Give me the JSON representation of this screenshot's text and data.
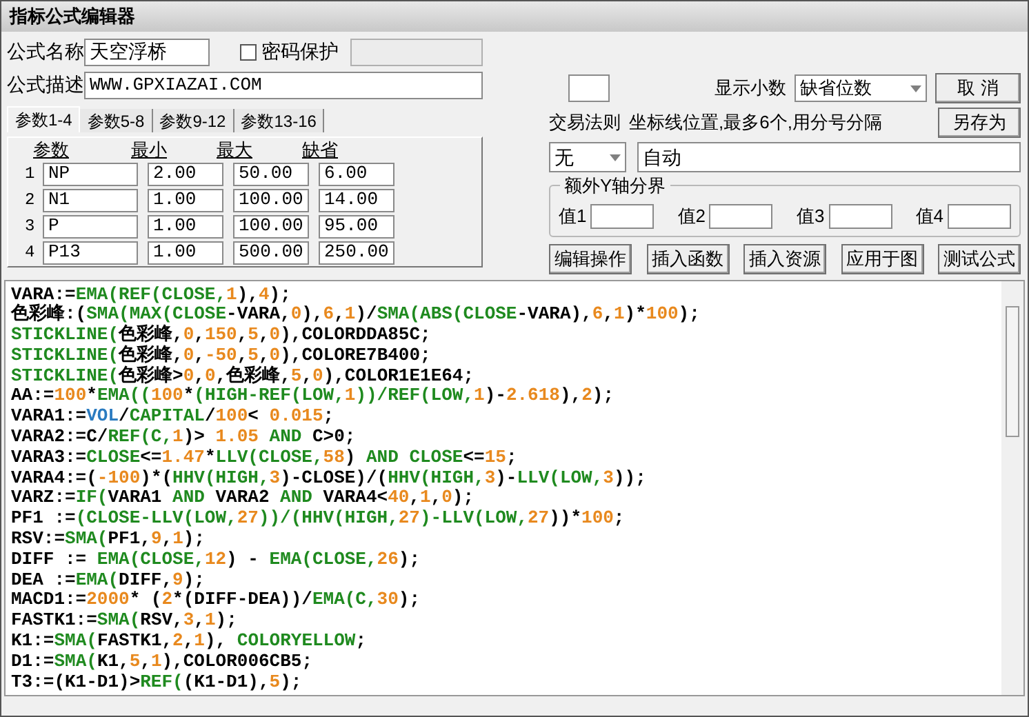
{
  "window": {
    "title": "指标公式编辑器"
  },
  "formula": {
    "name_label": "公式名称",
    "name_value": "天空浮桥",
    "password": {
      "label": "密码保护",
      "checked": false,
      "field_disabled": true
    },
    "description_label": "公式描述",
    "description_value": "WWW.GPXIAZAI.COM"
  },
  "param_tabs": [
    {
      "label": "参数1-4",
      "selected": true
    },
    {
      "label": "参数5-8",
      "selected": false
    },
    {
      "label": "参数9-12",
      "selected": false
    },
    {
      "label": "参数13-16",
      "selected": false
    }
  ],
  "params": {
    "columns": [
      "参数",
      "最小",
      "最大",
      "缺省"
    ],
    "rows": [
      {
        "index": "1",
        "name": "NP",
        "min": "2.00",
        "max": "50.00",
        "default": "6.00"
      },
      {
        "index": "2",
        "name": "N1",
        "min": "1.00",
        "max": "100.00",
        "default": "14.00"
      },
      {
        "index": "3",
        "name": "P",
        "min": "1.00",
        "max": "100.00",
        "default": "95.00"
      },
      {
        "index": "4",
        "name": "P13",
        "min": "1.00",
        "max": "500.00",
        "default": "250.00"
      }
    ]
  },
  "display": {
    "digits_label": "显示小数",
    "digits_value": "缺省位数",
    "cancel_button": "取  消"
  },
  "trade_rule": {
    "label": "交易法则",
    "value": "无"
  },
  "axis_lines": {
    "label": "坐标线位置,最多6个,用分号分隔",
    "value": "自动"
  },
  "extra_y": {
    "title": "额外Y轴分界",
    "values": [
      {
        "label": "值1"
      },
      {
        "label": "值2"
      },
      {
        "label": "值3"
      },
      {
        "label": "值4"
      }
    ]
  },
  "save_as_button": "另存为",
  "actions": [
    "编辑操作",
    "插入函数",
    "插入资源",
    "应用于图",
    "测试公式"
  ],
  "code": {
    "lines": [
      [
        {
          "kind": "p",
          "text": "VARA:="
        },
        {
          "kind": "f",
          "text": "EMA(REF(CLOSE,"
        },
        {
          "kind": "n",
          "text": "1"
        },
        {
          "kind": "p",
          "text": "),"
        },
        {
          "kind": "n",
          "text": "4"
        },
        {
          "kind": "p",
          "text": ");"
        }
      ],
      [
        {
          "kind": "p",
          "text": "色彩峰:("
        },
        {
          "kind": "f",
          "text": "SMA(MAX(CLOSE"
        },
        {
          "kind": "p",
          "text": "-VARA,"
        },
        {
          "kind": "n",
          "text": "0"
        },
        {
          "kind": "p",
          "text": "),"
        },
        {
          "kind": "n",
          "text": "6"
        },
        {
          "kind": "p",
          "text": ","
        },
        {
          "kind": "n",
          "text": "1"
        },
        {
          "kind": "p",
          "text": ")/"
        },
        {
          "kind": "f",
          "text": "SMA(ABS(CLOSE"
        },
        {
          "kind": "p",
          "text": "-VARA),"
        },
        {
          "kind": "n",
          "text": "6"
        },
        {
          "kind": "p",
          "text": ","
        },
        {
          "kind": "n",
          "text": "1"
        },
        {
          "kind": "p",
          "text": ")*"
        },
        {
          "kind": "n",
          "text": "100"
        },
        {
          "kind": "p",
          "text": ");"
        }
      ],
      [
        {
          "kind": "f",
          "text": "STICKLINE("
        },
        {
          "kind": "p",
          "text": "色彩峰,"
        },
        {
          "kind": "n",
          "text": "0"
        },
        {
          "kind": "p",
          "text": ","
        },
        {
          "kind": "n",
          "text": "150"
        },
        {
          "kind": "p",
          "text": ","
        },
        {
          "kind": "n",
          "text": "5"
        },
        {
          "kind": "p",
          "text": ","
        },
        {
          "kind": "n",
          "text": "0"
        },
        {
          "kind": "p",
          "text": "),COLORDDA85C;"
        }
      ],
      [
        {
          "kind": "f",
          "text": "STICKLINE("
        },
        {
          "kind": "p",
          "text": "色彩峰,"
        },
        {
          "kind": "n",
          "text": "0"
        },
        {
          "kind": "p",
          "text": ","
        },
        {
          "kind": "n",
          "text": "-50"
        },
        {
          "kind": "p",
          "text": ","
        },
        {
          "kind": "n",
          "text": "5"
        },
        {
          "kind": "p",
          "text": ","
        },
        {
          "kind": "n",
          "text": "0"
        },
        {
          "kind": "p",
          "text": "),COLORE7B400;"
        }
      ],
      [
        {
          "kind": "f",
          "text": "STICKLINE("
        },
        {
          "kind": "p",
          "text": "色彩峰>"
        },
        {
          "kind": "n",
          "text": "0"
        },
        {
          "kind": "p",
          "text": ","
        },
        {
          "kind": "n",
          "text": "0"
        },
        {
          "kind": "p",
          "text": ",色彩峰,"
        },
        {
          "kind": "n",
          "text": "5"
        },
        {
          "kind": "p",
          "text": ","
        },
        {
          "kind": "n",
          "text": "0"
        },
        {
          "kind": "p",
          "text": "),COLOR1E1E64;"
        }
      ],
      [
        {
          "kind": "p",
          "text": "AA:="
        },
        {
          "kind": "n",
          "text": "100"
        },
        {
          "kind": "p",
          "text": "*"
        },
        {
          "kind": "f",
          "text": "EMA(("
        },
        {
          "kind": "n",
          "text": "100"
        },
        {
          "kind": "p",
          "text": "*"
        },
        {
          "kind": "f",
          "text": "(HIGH-REF(LOW,"
        },
        {
          "kind": "n",
          "text": "1"
        },
        {
          "kind": "f",
          "text": "))/REF(LOW,"
        },
        {
          "kind": "n",
          "text": "1"
        },
        {
          "kind": "p",
          "text": ")-"
        },
        {
          "kind": "n",
          "text": "2.618"
        },
        {
          "kind": "p",
          "text": "),"
        },
        {
          "kind": "n",
          "text": "2"
        },
        {
          "kind": "p",
          "text": ");"
        }
      ],
      [
        {
          "kind": "p",
          "text": "VARA1:="
        },
        {
          "kind": "v",
          "text": "VOL"
        },
        {
          "kind": "p",
          "text": "/"
        },
        {
          "kind": "f",
          "text": "CAPITAL"
        },
        {
          "kind": "p",
          "text": "/"
        },
        {
          "kind": "n",
          "text": "100"
        },
        {
          "kind": "p",
          "text": "< "
        },
        {
          "kind": "n",
          "text": "0.015"
        },
        {
          "kind": "p",
          "text": ";"
        }
      ],
      [
        {
          "kind": "p",
          "text": "VARA2:=C/"
        },
        {
          "kind": "f",
          "text": "REF(C,"
        },
        {
          "kind": "n",
          "text": "1"
        },
        {
          "kind": "p",
          "text": ")> "
        },
        {
          "kind": "n",
          "text": "1.05"
        },
        {
          "kind": "f",
          "text": " AND "
        },
        {
          "kind": "p",
          "text": "C>0;"
        }
      ],
      [
        {
          "kind": "p",
          "text": "VARA3:="
        },
        {
          "kind": "f",
          "text": "CLOSE"
        },
        {
          "kind": "p",
          "text": "<="
        },
        {
          "kind": "n",
          "text": "1.47"
        },
        {
          "kind": "p",
          "text": "*"
        },
        {
          "kind": "f",
          "text": "LLV(CLOSE,"
        },
        {
          "kind": "n",
          "text": "58"
        },
        {
          "kind": "p",
          "text": ") "
        },
        {
          "kind": "f",
          "text": "AND CLOSE"
        },
        {
          "kind": "p",
          "text": "<="
        },
        {
          "kind": "n",
          "text": "15"
        },
        {
          "kind": "p",
          "text": ";"
        }
      ],
      [
        {
          "kind": "p",
          "text": "VARA4:=("
        },
        {
          "kind": "n",
          "text": "-100"
        },
        {
          "kind": "p",
          "text": ")*("
        },
        {
          "kind": "f",
          "text": "HHV(HIGH,"
        },
        {
          "kind": "n",
          "text": "3"
        },
        {
          "kind": "p",
          "text": ")-CLOSE)/("
        },
        {
          "kind": "f",
          "text": "HHV(HIGH,"
        },
        {
          "kind": "n",
          "text": "3"
        },
        {
          "kind": "p",
          "text": ")-"
        },
        {
          "kind": "f",
          "text": "LLV(LOW,"
        },
        {
          "kind": "n",
          "text": "3"
        },
        {
          "kind": "p",
          "text": "));"
        }
      ],
      [
        {
          "kind": "p",
          "text": "VARZ:="
        },
        {
          "kind": "f",
          "text": "IF("
        },
        {
          "kind": "p",
          "text": "VARA1 "
        },
        {
          "kind": "f",
          "text": "AND"
        },
        {
          "kind": "p",
          "text": " VARA2 "
        },
        {
          "kind": "f",
          "text": "AND"
        },
        {
          "kind": "p",
          "text": " VARA4<"
        },
        {
          "kind": "n",
          "text": "40"
        },
        {
          "kind": "p",
          "text": ","
        },
        {
          "kind": "n",
          "text": "1"
        },
        {
          "kind": "p",
          "text": ","
        },
        {
          "kind": "n",
          "text": "0"
        },
        {
          "kind": "p",
          "text": ");"
        }
      ],
      [
        {
          "kind": "p",
          "text": "PF1 :="
        },
        {
          "kind": "f",
          "text": "(CLOSE-LLV(LOW,"
        },
        {
          "kind": "n",
          "text": "27"
        },
        {
          "kind": "f",
          "text": "))/(HHV(HIGH,"
        },
        {
          "kind": "n",
          "text": "27"
        },
        {
          "kind": "f",
          "text": ")-LLV(LOW,"
        },
        {
          "kind": "n",
          "text": "27"
        },
        {
          "kind": "p",
          "text": "))*"
        },
        {
          "kind": "n",
          "text": "100"
        },
        {
          "kind": "p",
          "text": ";"
        }
      ],
      [
        {
          "kind": "p",
          "text": "RSV:="
        },
        {
          "kind": "f",
          "text": "SMA("
        },
        {
          "kind": "p",
          "text": "PF1,"
        },
        {
          "kind": "n",
          "text": "9"
        },
        {
          "kind": "p",
          "text": ","
        },
        {
          "kind": "n",
          "text": "1"
        },
        {
          "kind": "p",
          "text": ");"
        }
      ],
      [
        {
          "kind": "p",
          "text": "DIFF := "
        },
        {
          "kind": "f",
          "text": "EMA(CLOSE,"
        },
        {
          "kind": "n",
          "text": "12"
        },
        {
          "kind": "p",
          "text": ") - "
        },
        {
          "kind": "f",
          "text": "EMA(CLOSE,"
        },
        {
          "kind": "n",
          "text": "26"
        },
        {
          "kind": "p",
          "text": ");"
        }
      ],
      [
        {
          "kind": "p",
          "text": "DEA :="
        },
        {
          "kind": "f",
          "text": "EMA("
        },
        {
          "kind": "p",
          "text": "DIFF,"
        },
        {
          "kind": "n",
          "text": "9"
        },
        {
          "kind": "p",
          "text": ");"
        }
      ],
      [
        {
          "kind": "p",
          "text": "MACD1:="
        },
        {
          "kind": "n",
          "text": "2000"
        },
        {
          "kind": "p",
          "text": "* ("
        },
        {
          "kind": "n",
          "text": "2"
        },
        {
          "kind": "p",
          "text": "*(DIFF-DEA))/"
        },
        {
          "kind": "f",
          "text": "EMA(C,"
        },
        {
          "kind": "n",
          "text": "30"
        },
        {
          "kind": "p",
          "text": ");"
        }
      ],
      [
        {
          "kind": "p",
          "text": "FASTK1:="
        },
        {
          "kind": "f",
          "text": "SMA("
        },
        {
          "kind": "p",
          "text": "RSV,"
        },
        {
          "kind": "n",
          "text": "3"
        },
        {
          "kind": "p",
          "text": ","
        },
        {
          "kind": "n",
          "text": "1"
        },
        {
          "kind": "p",
          "text": ");"
        }
      ],
      [
        {
          "kind": "p",
          "text": "K1:="
        },
        {
          "kind": "f",
          "text": "SMA("
        },
        {
          "kind": "p",
          "text": "FASTK1,"
        },
        {
          "kind": "n",
          "text": "2"
        },
        {
          "kind": "p",
          "text": ","
        },
        {
          "kind": "n",
          "text": "1"
        },
        {
          "kind": "p",
          "text": "), "
        },
        {
          "kind": "f",
          "text": "COLORYELLOW"
        },
        {
          "kind": "p",
          "text": ";"
        }
      ],
      [
        {
          "kind": "p",
          "text": "D1:="
        },
        {
          "kind": "f",
          "text": "SMA("
        },
        {
          "kind": "p",
          "text": "K1,"
        },
        {
          "kind": "n",
          "text": "5"
        },
        {
          "kind": "p",
          "text": ","
        },
        {
          "kind": "n",
          "text": "1"
        },
        {
          "kind": "p",
          "text": "),COLOR006CB5;"
        }
      ],
      [
        {
          "kind": "p",
          "text": "T3:=(K1-D1)>"
        },
        {
          "kind": "f",
          "text": "REF("
        },
        {
          "kind": "p",
          "text": "(K1-D1),"
        },
        {
          "kind": "n",
          "text": "5"
        },
        {
          "kind": "p",
          "text": ");"
        }
      ]
    ]
  }
}
